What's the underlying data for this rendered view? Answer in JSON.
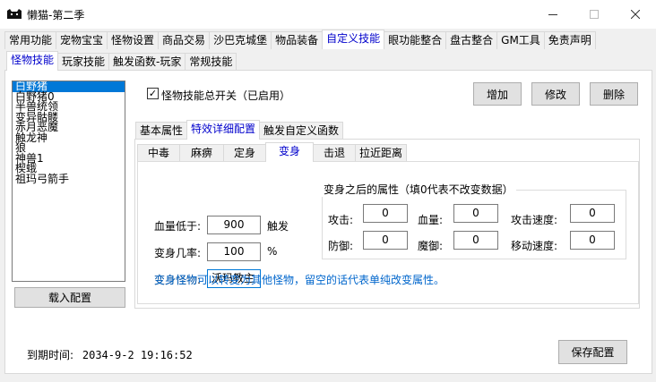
{
  "window": {
    "title": "懒猫-第二季"
  },
  "main_tabs": [
    "常用功能",
    "宠物宝宝",
    "怪物设置",
    "商品交易",
    "沙巴克城堡",
    "物品装备",
    "自定义技能",
    "眼功能整合",
    "盘古整合",
    "GM工具",
    "免责声明"
  ],
  "sub_tabs": [
    "怪物技能",
    "玩家技能",
    "触发函数-玩家",
    "常规技能"
  ],
  "monster_list": [
    "白野猪",
    "白野猪0",
    "半兽统领",
    "变异骷髅",
    "赤月恶魔",
    "触龙神",
    "狼",
    "神兽1",
    "楔蛾",
    "祖玛弓箭手"
  ],
  "load_button": "载入配置",
  "master_switch_label": "怪物技能总开关（已启用）",
  "actions": {
    "add": "增加",
    "modify": "修改",
    "delete": "删除"
  },
  "config_tabs": [
    "基本属性",
    "特效详细配置",
    "触发自定义函数"
  ],
  "effect_tabs": [
    "中毒",
    "麻痹",
    "定身",
    "变身",
    "击退",
    "拉近距离"
  ],
  "transform": {
    "hp_below_label": "血量低于:",
    "hp_below_value": "900",
    "trigger_suffix": "触发",
    "chance_label": "变身几率:",
    "chance_value": "100",
    "chance_unit": "%",
    "monster_label": "变身怪物:",
    "monster_value": "沃玛教主",
    "after_title": "变身之后的属性（填0代表不改变数据）",
    "attack_label": "攻击:",
    "attack_value": "0",
    "hp_label": "血量:",
    "hp_value": "0",
    "attack_speed_label": "攻击速度:",
    "attack_speed_value": "0",
    "defense_label": "防御:",
    "defense_value": "0",
    "magic_def_label": "魔御:",
    "magic_def_value": "0",
    "move_speed_label": "移动速度:",
    "move_speed_value": "0",
    "hint": "变身怪物可以转变为其他怪物，留空的话代表单纯改变属性。"
  },
  "status": {
    "expiry_label": "到期时间:",
    "expiry_value": "2034-9-2 19:16:52"
  },
  "save_button": "保存配置",
  "colors": {
    "accent": "#0078d7",
    "active_tab_text": "#0000cc",
    "hint_text": "#0066cc"
  }
}
